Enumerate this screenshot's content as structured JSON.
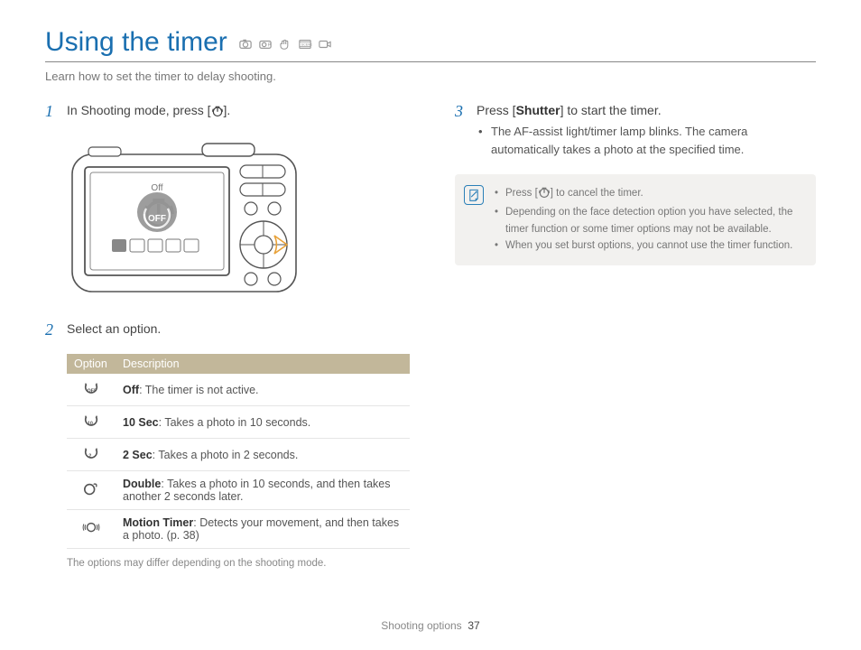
{
  "title": "Using the timer",
  "intro": "Learn how to set the timer to delay shooting.",
  "steps": {
    "s1": {
      "num": "1",
      "prefix": "In Shooting mode, press [",
      "suffix": "]."
    },
    "s2": {
      "num": "2",
      "text": "Select an option."
    },
    "s3": {
      "num": "3",
      "prefix": "Press [",
      "bold": "Shutter",
      "suffix": "] to start the timer.",
      "bullet1": "The AF-assist light/timer lamp blinks. The camera automatically takes a photo at the specified time."
    }
  },
  "table": {
    "h1": "Option",
    "h2": "Description",
    "rows": [
      {
        "name": "Off",
        "desc": ": The timer is not active."
      },
      {
        "name": "10 Sec",
        "desc": ": Takes a photo in 10 seconds."
      },
      {
        "name": "2 Sec",
        "desc": ": Takes a photo in 2 seconds."
      },
      {
        "name": "Double",
        "desc": ": Takes a photo in 10 seconds, and then takes another 2 seconds later."
      },
      {
        "name": "Motion Timer",
        "desc": ": Detects your movement, and then takes a photo. (p. 38)"
      }
    ],
    "footnote": "The options may differ depending on the shooting mode."
  },
  "tips": {
    "t1a": "Press [",
    "t1b": "] to cancel the timer.",
    "t2": "Depending on the face detection option you have selected, the timer function or some timer options may not be available.",
    "t3": "When you set burst options, you cannot use the timer function."
  },
  "footer": {
    "section": "Shooting options",
    "page": "37"
  },
  "camera_label": "Off"
}
